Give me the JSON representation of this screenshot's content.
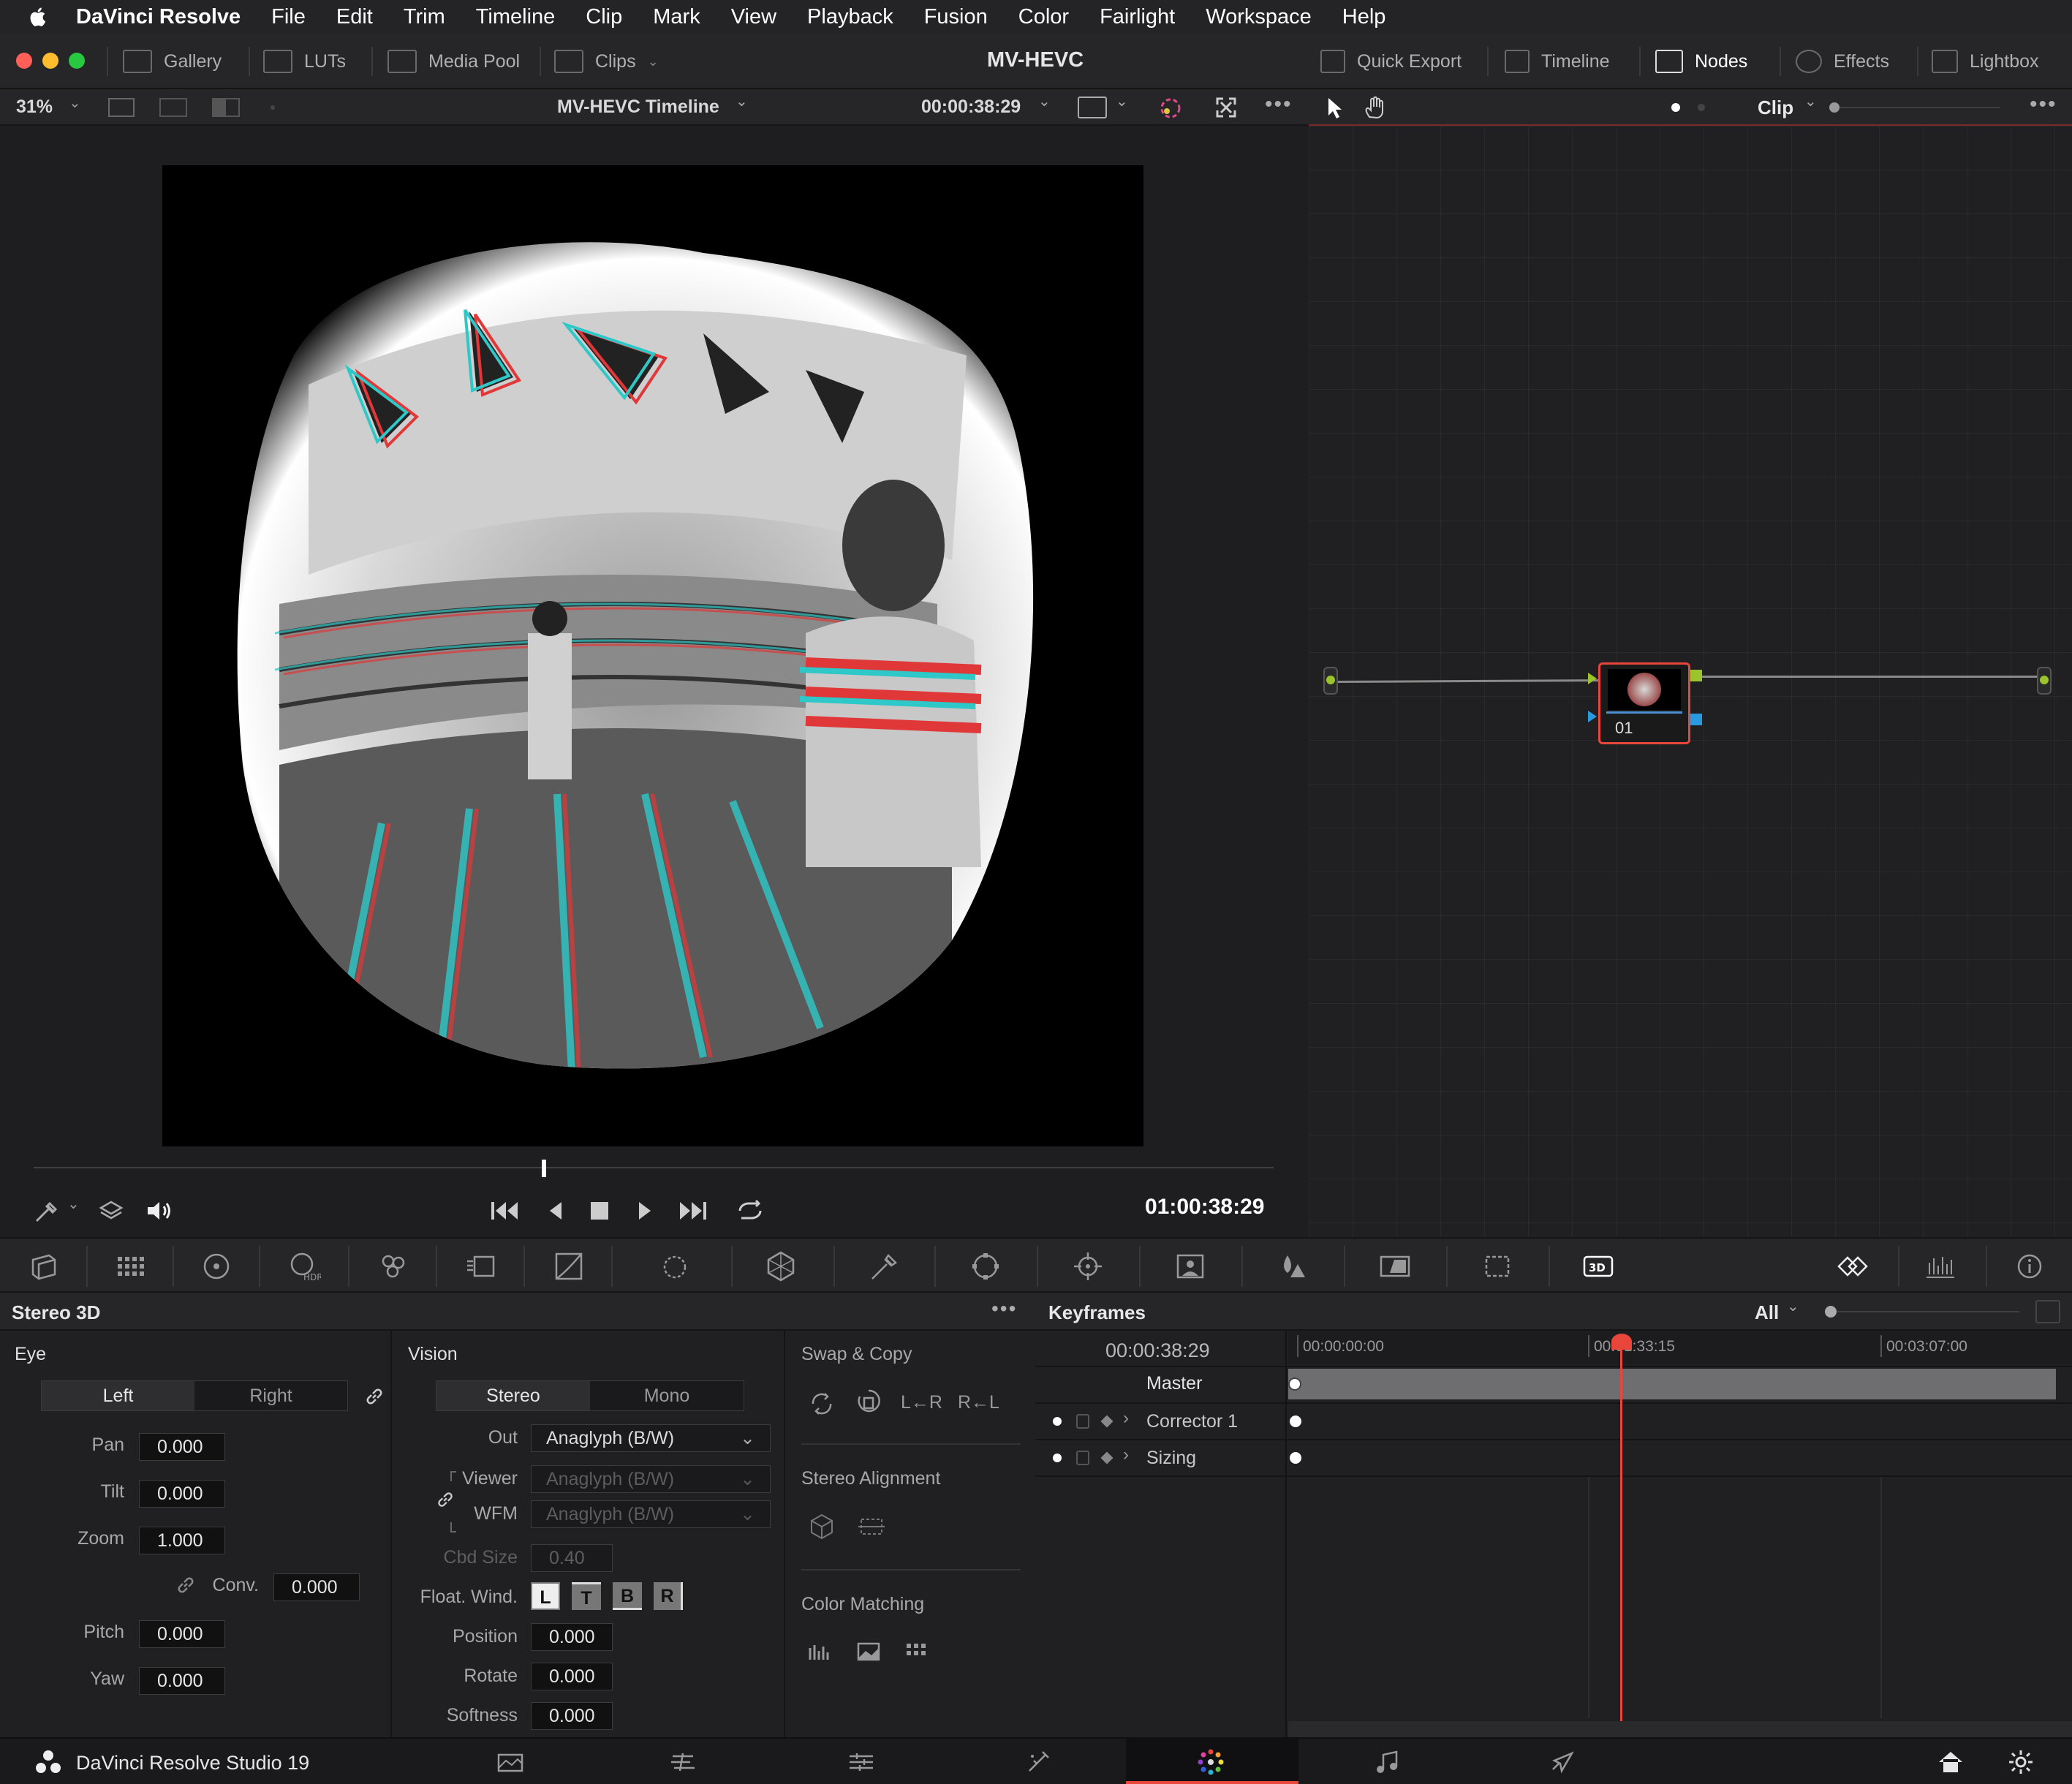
{
  "menubar": {
    "app_name": "DaVinci Resolve",
    "items": [
      "File",
      "Edit",
      "Trim",
      "Timeline",
      "Clip",
      "Mark",
      "View",
      "Playback",
      "Fusion",
      "Color",
      "Fairlight",
      "Workspace",
      "Help"
    ]
  },
  "toolbar": {
    "title": "MV-HEVC",
    "left": [
      {
        "label": "Gallery"
      },
      {
        "label": "LUTs"
      },
      {
        "label": "Media Pool"
      },
      {
        "label": "Clips"
      }
    ],
    "right": [
      {
        "label": "Quick Export"
      },
      {
        "label": "Timeline"
      },
      {
        "label": "Nodes"
      },
      {
        "label": "Effects"
      },
      {
        "label": "Lightbox"
      }
    ]
  },
  "viewer": {
    "zoom": "31%",
    "timeline_name": "MV-HEVC Timeline",
    "timecode_top": "00:00:38:29",
    "timecode_bottom": "01:00:38:29",
    "playhead_fraction": 0.41
  },
  "node_editor": {
    "mode": "Clip",
    "node_label": "01"
  },
  "stereo": {
    "title": "Stereo 3D",
    "eye": {
      "title": "Eye",
      "left": "Left",
      "right": "Right",
      "pan_label": "Pan",
      "pan": "0.000",
      "tilt_label": "Tilt",
      "tilt": "0.000",
      "zoom_label": "Zoom",
      "zoom": "1.000",
      "conv_label": "Conv.",
      "conv": "0.000",
      "pitch_label": "Pitch",
      "pitch": "0.000",
      "yaw_label": "Yaw",
      "yaw": "0.000"
    },
    "vision": {
      "title": "Vision",
      "stereo": "Stereo",
      "mono": "Mono",
      "out_label": "Out",
      "out": "Anaglyph (B/W)",
      "viewer_label": "Viewer",
      "viewer": "Anaglyph (B/W)",
      "wfm_label": "WFM",
      "wfm": "Anaglyph (B/W)",
      "cbd_label": "Cbd Size",
      "cbd": "0.40",
      "float_label": "Float. Wind.",
      "float_buttons": [
        "L",
        "T",
        "B",
        "R"
      ],
      "position_label": "Position",
      "position": "0.000",
      "rotate_label": "Rotate",
      "rotate": "0.000",
      "softness_label": "Softness",
      "softness": "0.000"
    },
    "swap": {
      "title": "Swap & Copy",
      "l_to_r": "L←R",
      "r_to_l": "R←L",
      "alignment_title": "Stereo Alignment",
      "matching_title": "Color Matching"
    }
  },
  "keyframes": {
    "title": "Keyframes",
    "filter": "All",
    "timecode": "00:00:38:29",
    "ruler": [
      "00:00:00:00",
      "00:01:33:15",
      "00:03:07:00"
    ],
    "tracks": [
      "Master",
      "Corrector 1",
      "Sizing"
    ]
  },
  "pagebar": {
    "product": "DaVinci Resolve Studio 19"
  },
  "colors": {
    "accent_red": "#e8463a",
    "node_green": "#9ac32c",
    "node_blue": "#2a9ae0"
  }
}
